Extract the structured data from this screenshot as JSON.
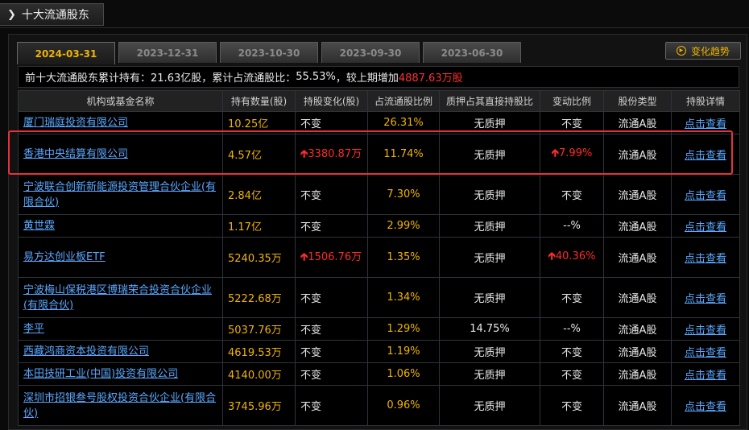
{
  "header": {
    "title": "十大流通股东"
  },
  "tabs": [
    {
      "label": "2024-03-31",
      "active": true
    },
    {
      "label": "2023-12-31",
      "active": false
    },
    {
      "label": "2023-10-30",
      "active": false
    },
    {
      "label": "2023-09-30",
      "active": false
    },
    {
      "label": "2023-06-30",
      "active": false
    }
  ],
  "trend_button": {
    "label": "变化趋势"
  },
  "summary": {
    "prefix": "前十大流通股东累计持有：",
    "total_shares": "21.63亿股",
    "ratio_label": "，累计占流通股比：",
    "ratio": "55.53%",
    "increase_label": "，较上期增加",
    "increase": "4887.63万股"
  },
  "table": {
    "columns": [
      "机构或基金名称",
      "持有数量(股)",
      "持股变化(股)",
      "占流通股比例",
      "质押占其直接持股比",
      "变动比例",
      "股份类型",
      "持股详情"
    ],
    "rows": [
      {
        "name": "厦门瑞庭投资有限公司",
        "shares": "10.25亿",
        "change": "不变",
        "change_up": false,
        "ratio": "26.31%",
        "pledge": "无质押",
        "change_ratio": "不变",
        "ratio_up": false,
        "type": "流通A股",
        "detail": "点击查看"
      },
      {
        "name": "香港中央结算有限公司",
        "shares": "4.57亿",
        "change": "3380.87万",
        "change_up": true,
        "ratio": "11.74%",
        "pledge": "无质押",
        "change_ratio": "7.99%",
        "ratio_up": true,
        "type": "流通A股",
        "detail": "点击查看"
      },
      {
        "name": "宁波联合创新新能源投资管理合伙企业(有限合伙)",
        "shares": "2.84亿",
        "change": "不变",
        "change_up": false,
        "ratio": "7.30%",
        "pledge": "无质押",
        "change_ratio": "不变",
        "ratio_up": false,
        "type": "流通A股",
        "detail": "点击查看"
      },
      {
        "name": "黄世霖",
        "shares": "1.17亿",
        "change": "不变",
        "change_up": false,
        "ratio": "2.99%",
        "pledge": "无质押",
        "change_ratio": "--%",
        "ratio_up": false,
        "type": "流通A股",
        "detail": "点击查看"
      },
      {
        "name": "易方达创业板ETF",
        "shares": "5240.35万",
        "change": "1506.76万",
        "change_up": true,
        "ratio": "1.35%",
        "pledge": "无质押",
        "change_ratio": "40.36%",
        "ratio_up": true,
        "type": "流通A股",
        "detail": "点击查看"
      },
      {
        "name": "宁波梅山保税港区博瑞荣合投资合伙企业(有限合伙)",
        "shares": "5222.68万",
        "change": "不变",
        "change_up": false,
        "ratio": "1.34%",
        "pledge": "无质押",
        "change_ratio": "不变",
        "ratio_up": false,
        "type": "流通A股",
        "detail": "点击查看"
      },
      {
        "name": "李平",
        "shares": "5037.76万",
        "change": "不变",
        "change_up": false,
        "ratio": "1.29%",
        "pledge": "14.75%",
        "change_ratio": "--%",
        "ratio_up": false,
        "type": "流通A股",
        "detail": "点击查看"
      },
      {
        "name": "西藏鸿商资本投资有限公司",
        "shares": "4619.53万",
        "change": "不变",
        "change_up": false,
        "ratio": "1.19%",
        "pledge": "无质押",
        "change_ratio": "不变",
        "ratio_up": false,
        "type": "流通A股",
        "detail": "点击查看"
      },
      {
        "name": "本田技研工业(中国)投资有限公司",
        "shares": "4140.00万",
        "change": "不变",
        "change_up": false,
        "ratio": "1.06%",
        "pledge": "无质押",
        "change_ratio": "不变",
        "ratio_up": false,
        "type": "流通A股",
        "detail": "点击查看"
      },
      {
        "name": "深圳市招银叁号股权投资合伙企业(有限合伙)",
        "shares": "3745.96万",
        "change": "不变",
        "change_up": false,
        "ratio": "0.96%",
        "pledge": "无质押",
        "change_ratio": "不变",
        "ratio_up": false,
        "type": "流通A股",
        "detail": "点击查看"
      }
    ]
  },
  "colors": {
    "accent": "#f0b400",
    "up": "#ff2a2a",
    "link": "#5aa8ff",
    "highlight": "#e8323a"
  },
  "icons": {
    "title_arrow": "chevron-right-icon",
    "trend": "play-circle-icon",
    "up": "arrow-up-icon"
  }
}
